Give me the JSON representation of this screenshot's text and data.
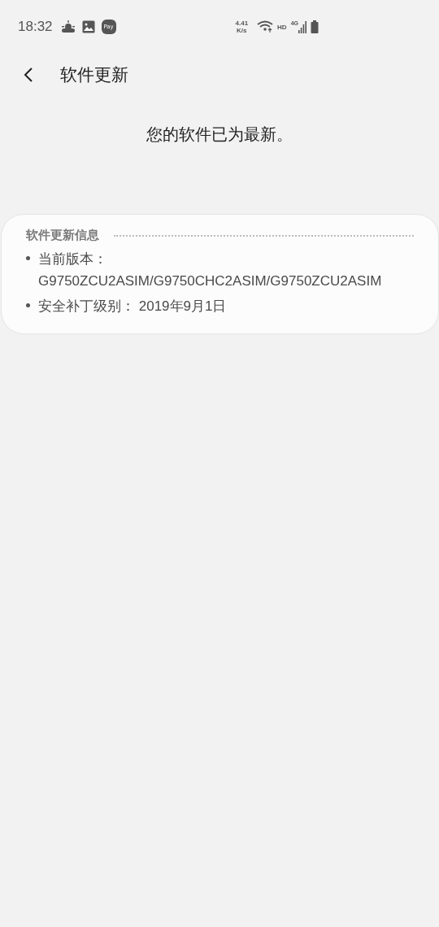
{
  "status_bar": {
    "time": "18:32",
    "pay_badge": "Pay",
    "net_speed": "4.41",
    "net_speed_unit": "K/s",
    "hd": "HD",
    "network": "4G"
  },
  "header": {
    "title": "软件更新"
  },
  "message": "您的软件已为最新。",
  "info_card": {
    "title": "软件更新信息",
    "items": [
      "当前版本：G9750ZCU2ASIM/G9750CHC2ASIM/G9750ZCU2ASIM",
      "安全补丁级别： 2019年9月1日"
    ]
  }
}
